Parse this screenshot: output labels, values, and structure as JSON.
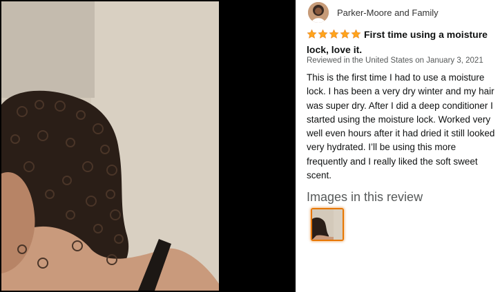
{
  "reviewer": {
    "name": "Parker-Moore and Family",
    "avatar_icon": "user-avatar-photo"
  },
  "review": {
    "rating": 5,
    "rating_max": 5,
    "star_color": "#ffa41c",
    "star_icon": "star-filled-icon",
    "title": "First time using a moisture lock, love it.",
    "meta": "Reviewed in the United States on January 3, 2021",
    "body": "This is the first time I had to use a moisture lock. I has been a very dry winter and my hair was super dry. After I did a deep conditioner I started using the moisture lock. Worked very well even hours after it had dried it still looked very hydrated. I’ll be using this more frequently and I really liked the soft sweet scent."
  },
  "images_section": {
    "heading": "Images in this review",
    "thumbnails": [
      {
        "selected": true,
        "highlight_color": "#e77600"
      }
    ]
  },
  "viewer": {
    "background": "#000000"
  }
}
